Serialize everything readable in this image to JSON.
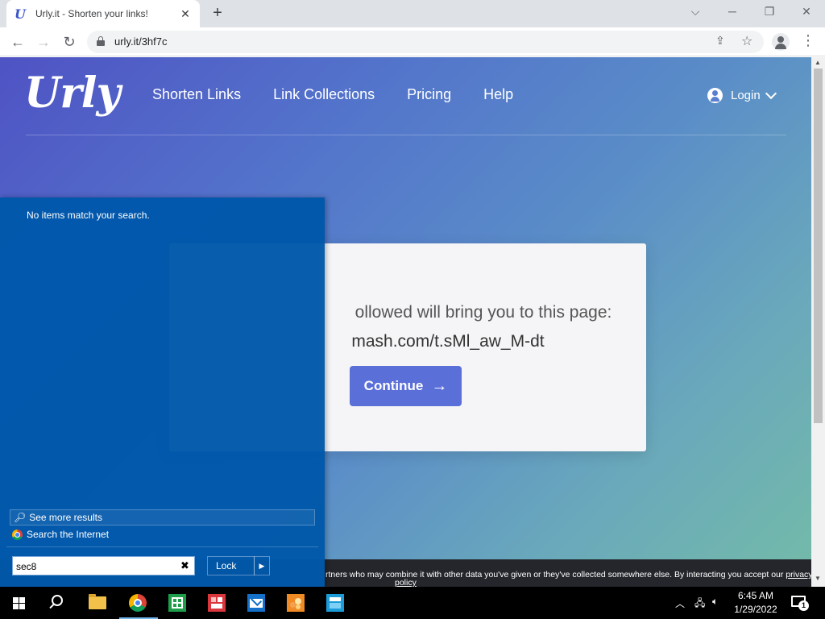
{
  "browser": {
    "tab_title": "Urly.it - Shorten your links!",
    "tab_favicon_glyph": "U",
    "url": "urly.it/3hf7c"
  },
  "site": {
    "logo": "Urly",
    "nav": [
      "Shorten Links",
      "Link Collections",
      "Pricing",
      "Help"
    ],
    "login_label": "Login"
  },
  "card": {
    "message_visible": "ollowed will bring you to this page:",
    "target_visible": "mash.com/t.sMl_aw_M-dt",
    "continue_label": "Continue"
  },
  "cookie_banner": {
    "line1": "rtners who may combine it with other data you've given or they've collected somewhere else. By interacting you accept our ",
    "link1": "privacy",
    "link2": "policy"
  },
  "start_menu": {
    "no_items": "No items match your search.",
    "see_more": "See more results",
    "search_internet": "Search the Internet",
    "search_value": "sec8",
    "lock_label": "Lock"
  },
  "taskbar": {
    "time": "6:45 AM",
    "date": "1/29/2022",
    "notification_count": "1"
  },
  "colors": {
    "start_menu_bg": "#0058aa",
    "continue_button": "#5a6fd8",
    "page_gradient_start": "#4f53c4",
    "page_gradient_end": "#74bba8"
  }
}
